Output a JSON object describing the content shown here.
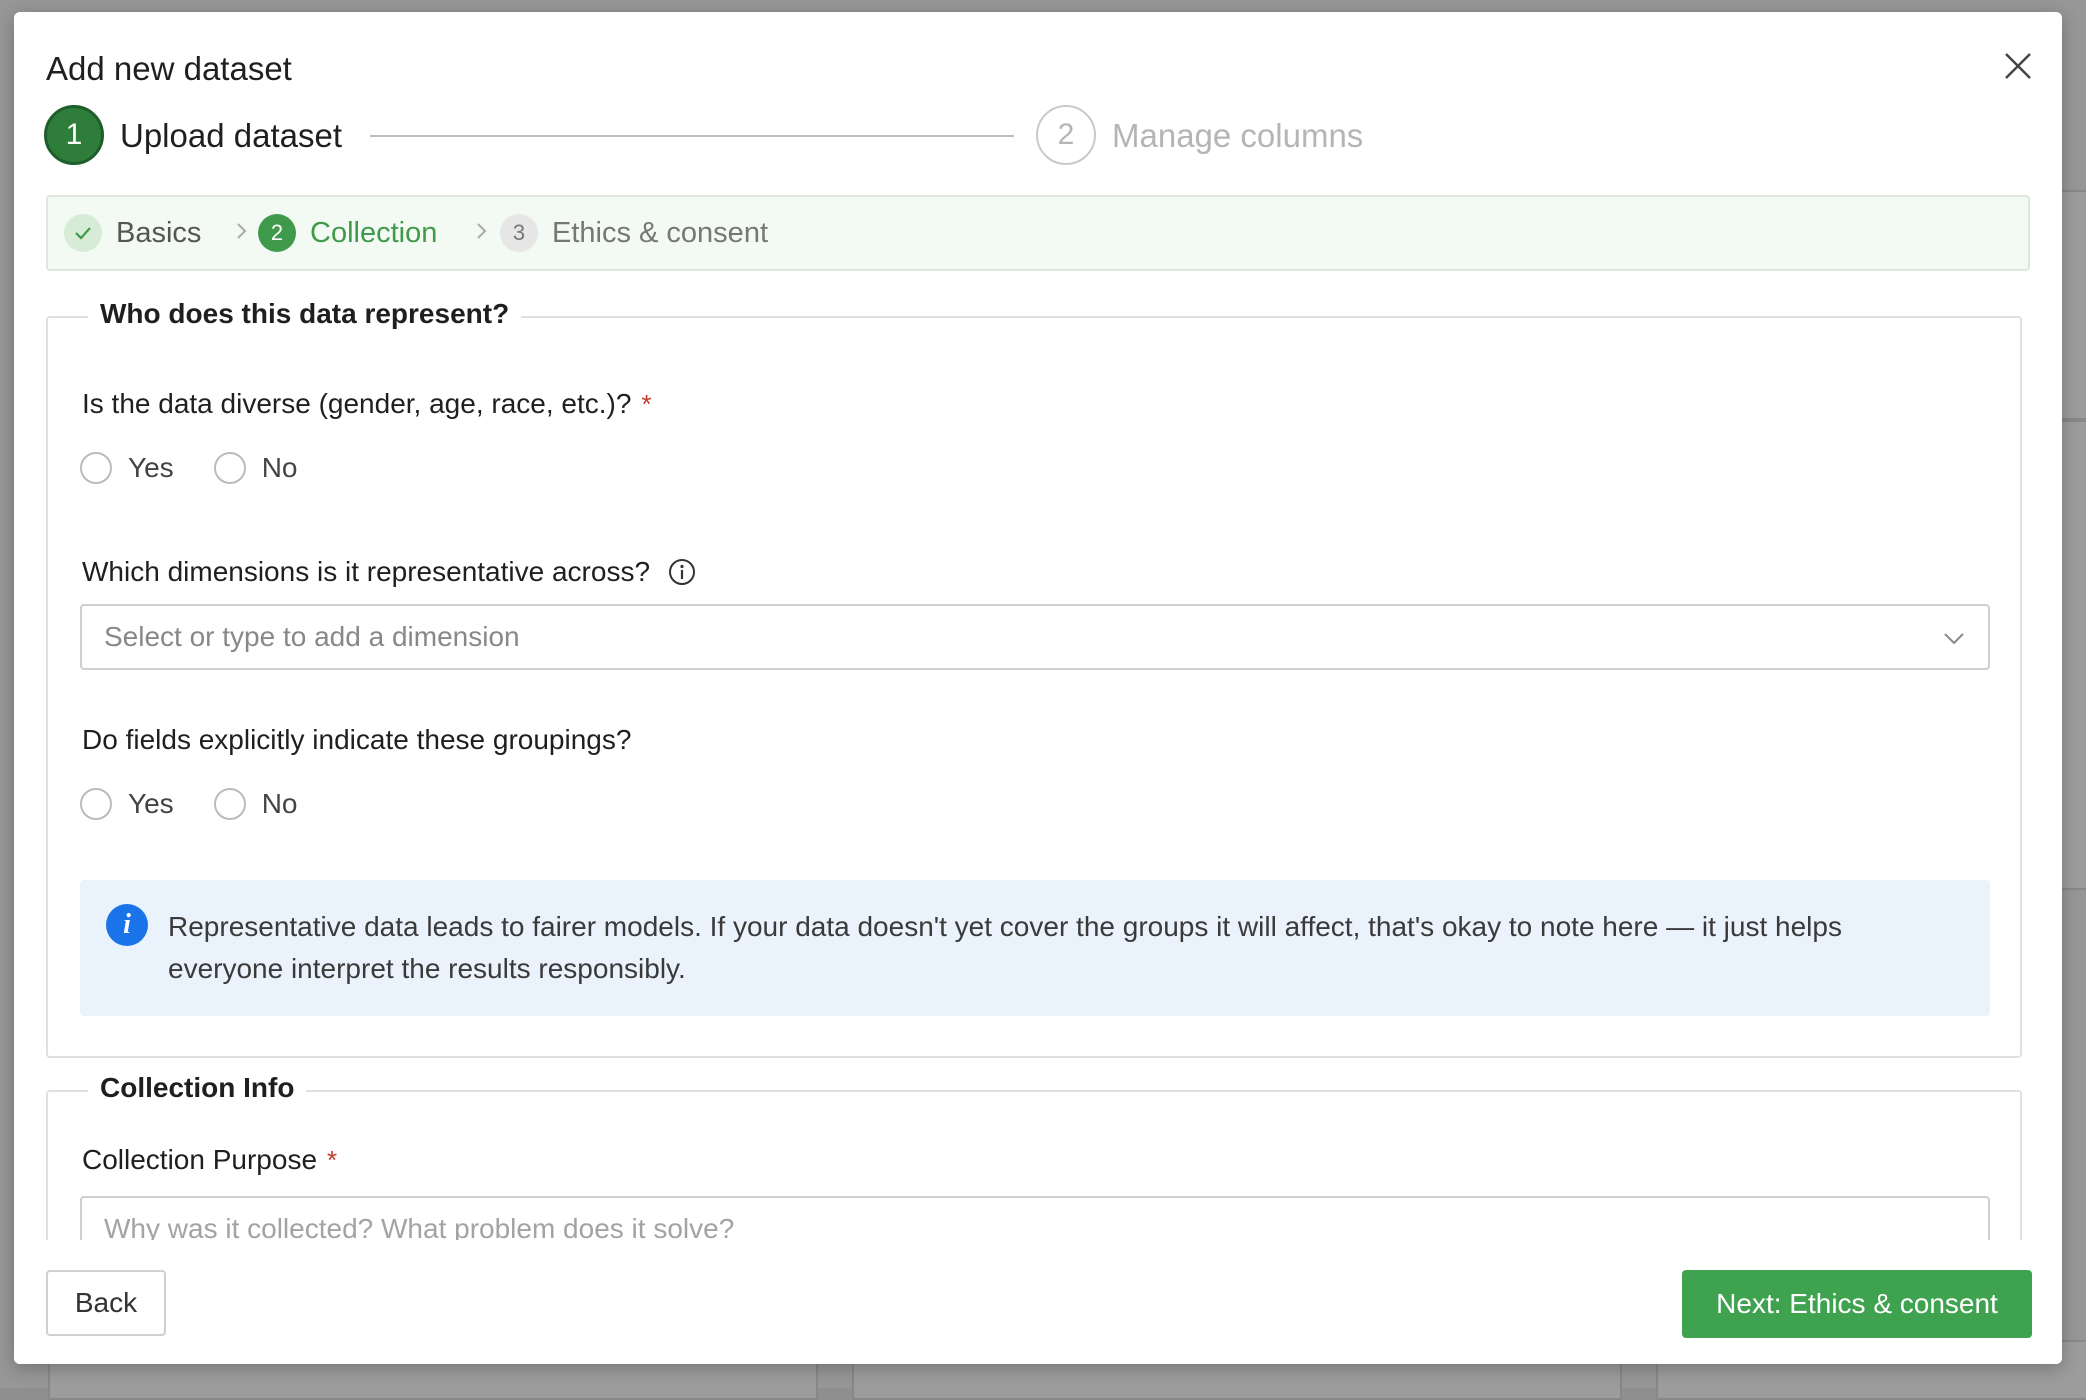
{
  "modal": {
    "title": "Add new dataset"
  },
  "stepper": {
    "steps": [
      {
        "number": "1",
        "label": "Upload dataset",
        "state": "active"
      },
      {
        "number": "2",
        "label": "Manage columns",
        "state": "inactive"
      }
    ]
  },
  "substeps": {
    "items": [
      {
        "marker": "✓",
        "label": "Basics",
        "state": "done"
      },
      {
        "marker": "2",
        "label": "Collection",
        "state": "current"
      },
      {
        "marker": "3",
        "label": "Ethics & consent",
        "state": "pending"
      }
    ]
  },
  "representation": {
    "legend": "Who does this data represent?",
    "diverse_question": "Is the data diverse (gender, age, race, etc.)?",
    "required_mark": "*",
    "yes_label": "Yes",
    "no_label": "No",
    "dimensions_question": "Which dimensions is it representative across?",
    "dimensions_placeholder": "Select or type to add a dimension",
    "groupings_question": "Do fields explicitly indicate these groupings?",
    "info_text": "Representative data leads to fairer models. If your data doesn't yet cover the groups it will affect, that's okay to note here — it just helps everyone interpret the results responsibly."
  },
  "collection_info": {
    "legend": "Collection Info",
    "purpose_label": "Collection Purpose",
    "required_mark": "*",
    "purpose_placeholder": "Why was it collected? What problem does it solve?"
  },
  "footer": {
    "back_label": "Back",
    "next_label": "Next: Ethics & consent"
  },
  "colors": {
    "primary_green": "#3fa24f",
    "active_step_green": "#2e7d3b",
    "info_blue": "#1a73e8",
    "required_red": "#c0392b"
  }
}
